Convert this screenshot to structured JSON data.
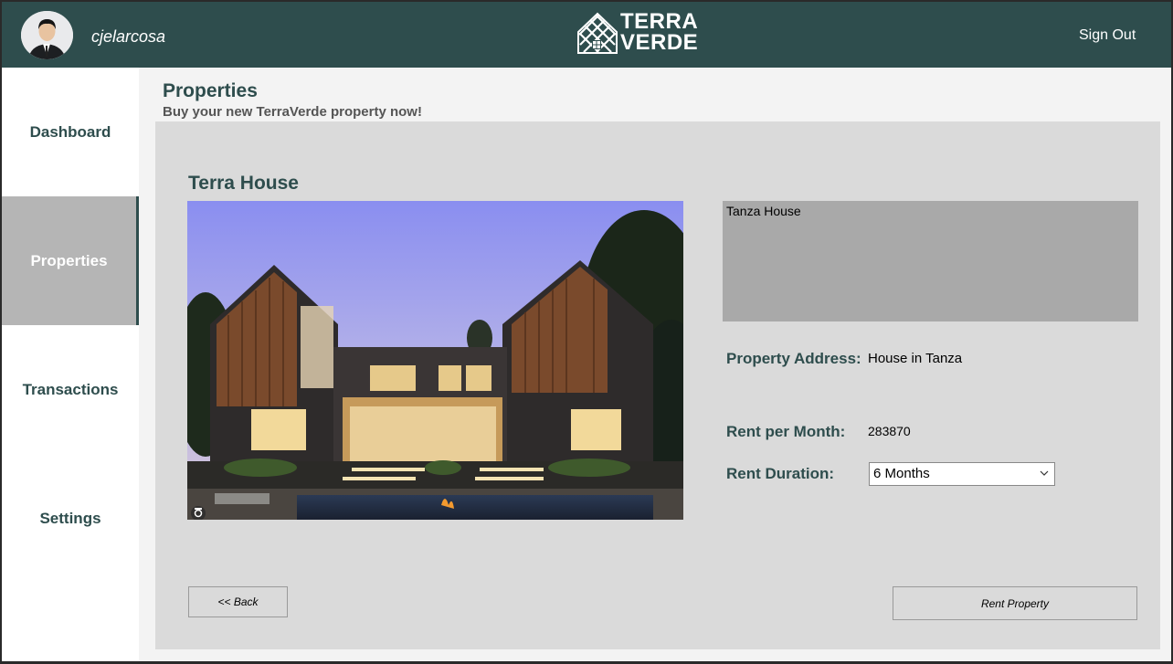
{
  "header": {
    "username": "cjelarcosa",
    "logo_line1": "TERRA",
    "logo_line2": "VERDE",
    "sign_out_label": "Sign Out"
  },
  "sidebar": {
    "items": [
      {
        "label": "Dashboard",
        "active": false
      },
      {
        "label": "Properties",
        "active": true
      },
      {
        "label": "Transactions",
        "active": false
      },
      {
        "label": "Settings",
        "active": false
      }
    ]
  },
  "page": {
    "title": "Properties",
    "subtitle": "Buy your new TerraVerde property now!"
  },
  "property": {
    "name": "Terra House",
    "description": "Tanza House",
    "address_label": "Property Address:",
    "address_value": "House in Tanza",
    "rent_label": "Rent per Month:",
    "rent_value": "283870",
    "duration_label": "Rent Duration:",
    "duration_selected": "6 Months"
  },
  "actions": {
    "back_label": "<< Back",
    "rent_label": "Rent Property"
  },
  "colors": {
    "brand": "#2e4d4d",
    "panel": "#dadada",
    "active_nav": "#b5b5b5"
  }
}
